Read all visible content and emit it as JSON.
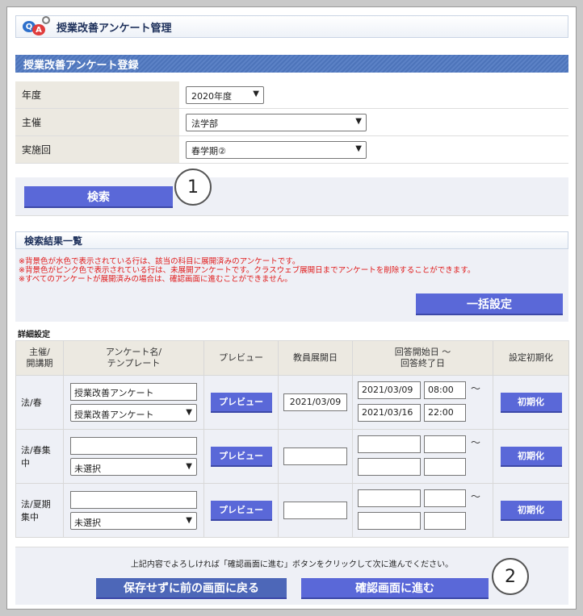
{
  "header": {
    "title": "授業改善アンケート管理"
  },
  "registration": {
    "section_title": "授業改善アンケート登録",
    "year": {
      "label": "年度",
      "value": "2020年度"
    },
    "organizer": {
      "label": "主催",
      "value": "法学部"
    },
    "session": {
      "label": "実施回",
      "value": "春学期②"
    },
    "search_label": "検索"
  },
  "results": {
    "section_title": "検索結果一覧",
    "notes": [
      "※背景色が水色で表示されている行は、該当の科目に展開済みのアンケートです。",
      "※背景色がピンク色で表示されている行は、未展開アンケートです。クラスウェブ展開日までアンケートを削除することができます。",
      "※すべてのアンケートが展開済みの場合は、確認画面に進むことができません。"
    ],
    "bulk_label": "一括設定",
    "detail_title": "詳細設定",
    "columns": [
      "主催/\n開講期",
      "アンケート名/\nテンプレート",
      "プレビュー",
      "教員展開日",
      "回答開始日 ～\n回答終了日",
      "設定初期化"
    ],
    "rows": [
      {
        "term": "法/春",
        "name": "授業改善アンケート",
        "template": "授業改善アンケート",
        "preview": "プレビュー",
        "teacher_date": "2021/03/09",
        "start_date": "2021/03/09",
        "start_time": "08:00",
        "end_date": "2021/03/16",
        "end_time": "22:00",
        "tilde": "～",
        "reset": "初期化"
      },
      {
        "term": "法/春集\n中",
        "name": "",
        "template": "未選択",
        "preview": "プレビュー",
        "teacher_date": "",
        "start_date": "",
        "start_time": "",
        "end_date": "",
        "end_time": "",
        "tilde": "～",
        "reset": "初期化"
      },
      {
        "term": "法/夏期\n集中",
        "name": "",
        "template": "未選択",
        "preview": "プレビュー",
        "teacher_date": "",
        "start_date": "",
        "start_time": "",
        "end_date": "",
        "end_time": "",
        "tilde": "～",
        "reset": "初期化"
      }
    ]
  },
  "footer": {
    "message": "上記内容でよろしければ「確認画面に進む」ボタンをクリックして次に進んでください。",
    "back_label": "保存せずに前の画面に戻る",
    "confirm_label": "確認画面に進む"
  },
  "callouts": {
    "one": "1",
    "two": "2"
  },
  "icons": {
    "logo": "qa-logo-icon",
    "dropdown": "chevron-down-icon"
  },
  "colors": {
    "accent": "#5a68d8",
    "section_bar": "#4d74ba",
    "note_text": "#e01919"
  }
}
